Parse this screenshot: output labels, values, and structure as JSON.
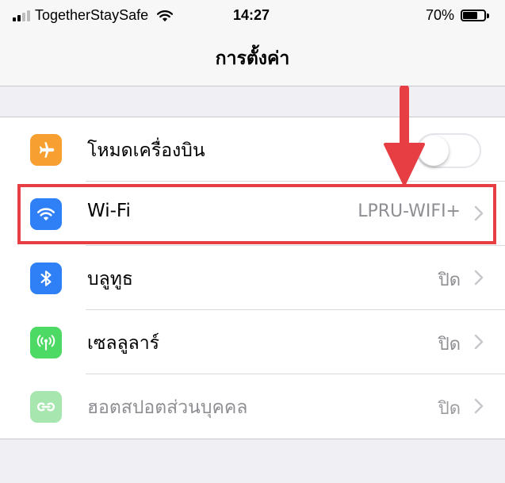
{
  "status_bar": {
    "carrier": "TogetherStaySafe",
    "time": "14:27",
    "battery_percent": "70%",
    "battery_level": 0.7,
    "signal_bars_on": 2,
    "signal_bars_total": 4
  },
  "nav": {
    "title": "การตั้งค่า"
  },
  "settings": {
    "rows": [
      {
        "label": "โหมดเครื่องบิน",
        "icon": "airplane-icon",
        "icon_color": "#f7a031",
        "control": "toggle",
        "toggle_on": false
      },
      {
        "label": "Wi-Fi",
        "icon": "wifi-icon",
        "icon_color": "#2f7ff6",
        "value": "LPRU-WIFI+"
      },
      {
        "label": "บลูทูธ",
        "icon": "bluetooth-icon",
        "icon_color": "#2f7ff6",
        "value": "ปิด"
      },
      {
        "label": "เซลลูลาร์",
        "icon": "cellular-icon",
        "icon_color": "#4cd964",
        "value": "ปิด"
      },
      {
        "label": "ฮอตสปอตส่วนบุคคล",
        "icon": "hotspot-icon",
        "icon_color": "#a8e6b0",
        "value": "ปิด",
        "disabled": true
      }
    ]
  },
  "annotation": {
    "highlight_color": "#e63e42"
  }
}
